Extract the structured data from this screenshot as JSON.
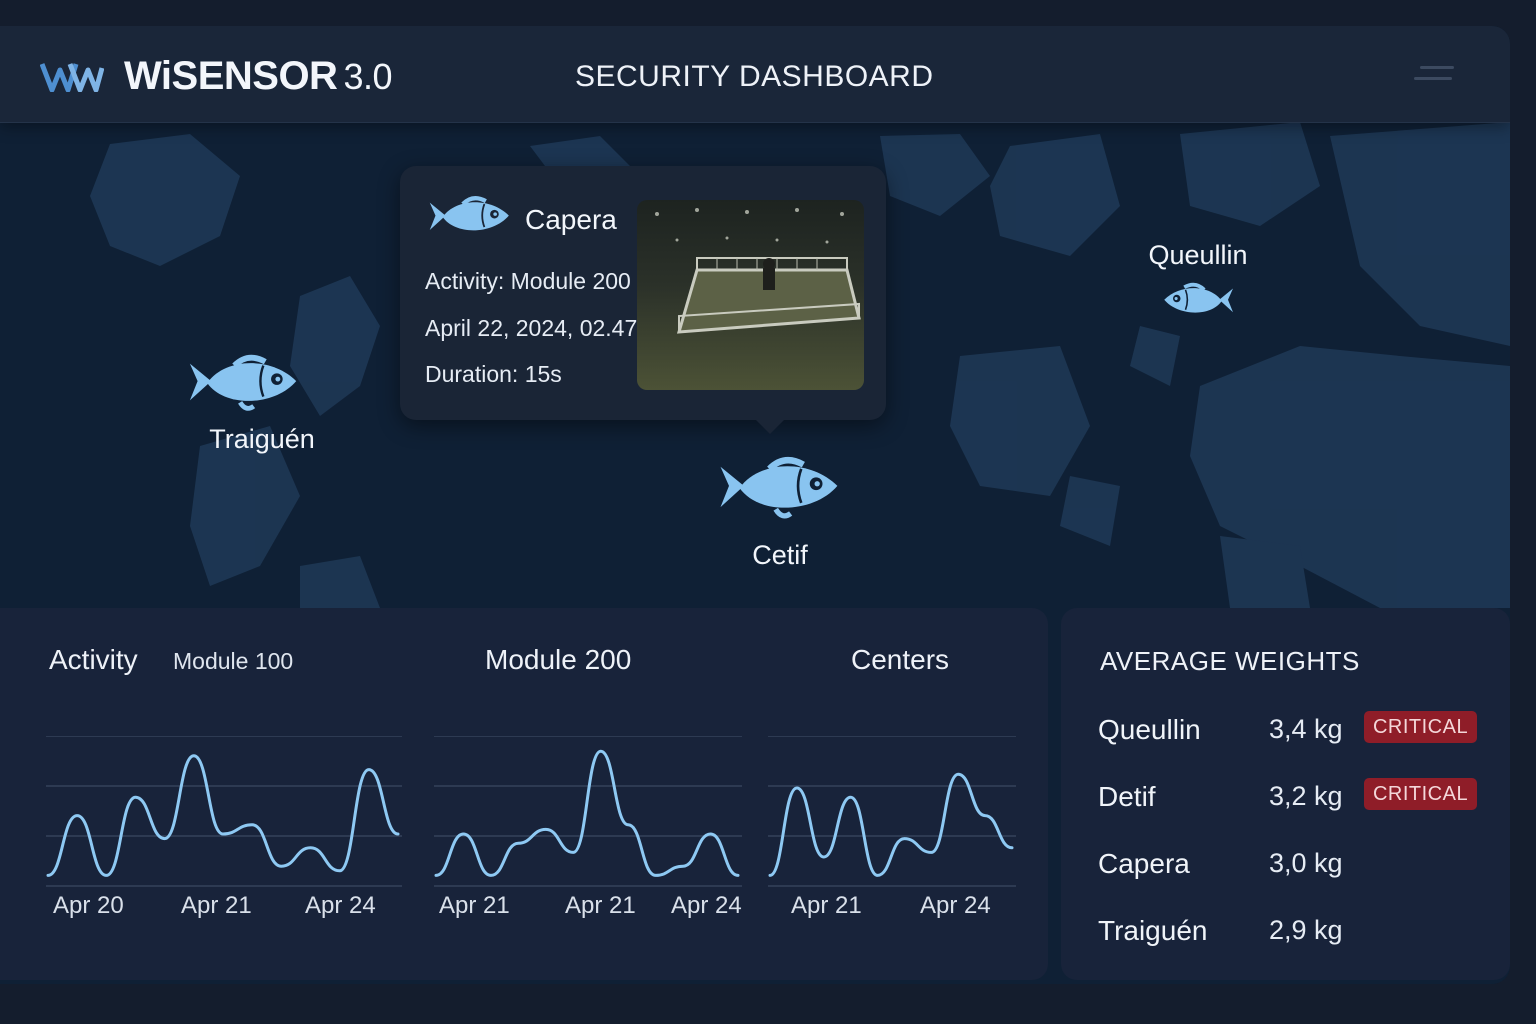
{
  "header": {
    "brand": "WiSENSOR",
    "version": "3.0",
    "title": "SECURITY DASHBOARD"
  },
  "map": {
    "markers": [
      {
        "id": "traiguen",
        "label": "Traiguén",
        "icon": "fish-icon"
      },
      {
        "id": "cetif",
        "label": "Cetif",
        "icon": "fish-icon"
      },
      {
        "id": "queullin",
        "label": "Queullin",
        "icon": "fish-icon"
      }
    ],
    "popup": {
      "site": "Capera",
      "activity_label": "Activity:",
      "activity_value": "Module 200",
      "datetime": "April 22, 2024, 02.47",
      "duration": "Duration: 15s",
      "thumbnail": "camera-snapshot"
    }
  },
  "charts_panel": {
    "title": "Activity",
    "subtitle": "Module 100"
  },
  "chart_data": [
    {
      "type": "line",
      "title": "Activity",
      "subtitle": "Module 100",
      "x": [
        "Apr 20",
        "",
        "",
        "",
        "Apr 21",
        "",
        "",
        "",
        "",
        "",
        "Apr 24",
        ""
      ],
      "tick_labels": [
        "Apr 20",
        "Apr 21",
        "Apr 24"
      ],
      "series": [
        {
          "values": [
            0.1,
            1.4,
            0.1,
            1.8,
            0.9,
            2.7,
            1.0,
            1.2,
            0.3,
            0.7,
            0.2,
            2.4,
            1.0
          ]
        }
      ],
      "ylim": [
        0,
        3
      ],
      "grid": true,
      "color": "#8ec9f3"
    },
    {
      "type": "line",
      "title": "Module 200",
      "x": [
        "Apr 21",
        "",
        "",
        "",
        "Apr 21",
        "",
        "",
        "",
        "Apr 24",
        ""
      ],
      "tick_labels": [
        "Apr 21",
        "Apr 21",
        "Apr 24"
      ],
      "series": [
        {
          "values": [
            0.1,
            1.0,
            0.1,
            0.8,
            1.1,
            0.6,
            2.8,
            1.2,
            0.1,
            0.3,
            1.0,
            0.1
          ]
        }
      ],
      "ylim": [
        0,
        3
      ],
      "grid": true,
      "color": "#8ec9f3"
    },
    {
      "type": "line",
      "title": "Centers",
      "x": [
        "Apr 21",
        "",
        "",
        "",
        "Apr 24",
        ""
      ],
      "tick_labels": [
        "Apr 21",
        "Apr 24"
      ],
      "series": [
        {
          "values": [
            0.1,
            2.0,
            0.5,
            1.8,
            0.1,
            0.9,
            0.6,
            2.3,
            1.4,
            0.7
          ]
        }
      ],
      "ylim": [
        0,
        3
      ],
      "grid": true,
      "color": "#8ec9f3"
    }
  ],
  "weights": {
    "title": "AVERAGE WEIGHTS",
    "rows": [
      {
        "name": "Queullin",
        "value": "3,4 kg",
        "badge": "CRITICAL"
      },
      {
        "name": "Detif",
        "value": "3,2 kg",
        "badge": "CRITICAL"
      },
      {
        "name": "Capera",
        "value": "3,0 kg",
        "badge": ""
      },
      {
        "name": "Traiguén",
        "value": "2,9 kg",
        "badge": ""
      }
    ],
    "badge_color": "#8f1d28"
  },
  "colors": {
    "accent": "#8ec9f3",
    "background": "#141d2d",
    "panel": "#18233a",
    "map_water": "#0f2035",
    "map_land": "#1f3957"
  }
}
